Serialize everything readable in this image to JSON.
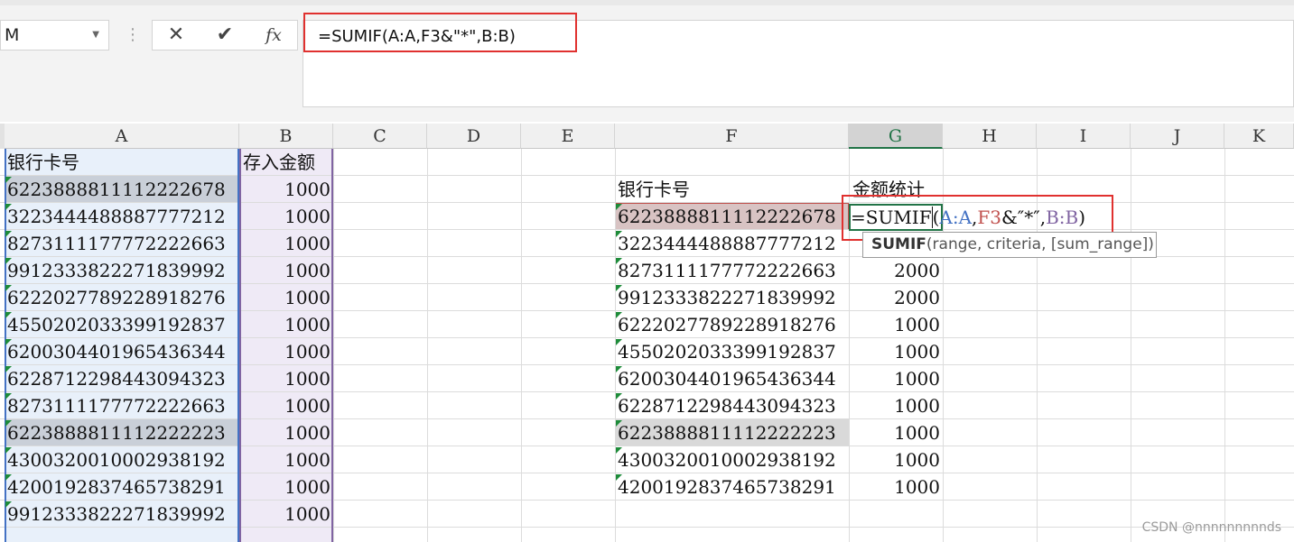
{
  "name_box": {
    "value": "M"
  },
  "formula_bar": {
    "cancel_icon": "✕",
    "enter_icon": "✔",
    "fx_label": "fx",
    "formula": "=SUMIF(A:A,F3&\"*\",B:B)"
  },
  "columns": [
    "A",
    "B",
    "C",
    "D",
    "E",
    "F",
    "G",
    "H",
    "I",
    "J",
    "K"
  ],
  "selected_column": "G",
  "left_table": {
    "header_card": "银行卡号",
    "header_amount": "存入金额",
    "rows": [
      {
        "card": "6223888811112222678",
        "amount": "1000"
      },
      {
        "card": "3223444488887777212",
        "amount": "1000"
      },
      {
        "card": "8273111177772222663",
        "amount": "1000"
      },
      {
        "card": "9912333822271839992",
        "amount": "1000"
      },
      {
        "card": "6222027789228918276",
        "amount": "1000"
      },
      {
        "card": "4550202033399192837",
        "amount": "1000"
      },
      {
        "card": "6200304401965436344",
        "amount": "1000"
      },
      {
        "card": "6228712298443094323",
        "amount": "1000"
      },
      {
        "card": "8273111177772222663",
        "amount": "1000"
      },
      {
        "card": "6223888811112222223",
        "amount": "1000"
      },
      {
        "card": "4300320010002938192",
        "amount": "1000"
      },
      {
        "card": "4200192837465738291",
        "amount": "1000"
      },
      {
        "card": "9912333822271839992",
        "amount": "1000"
      }
    ]
  },
  "right_table": {
    "header_card": "银行卡号",
    "header_total": "金额统计",
    "rows": [
      {
        "card": "6223888811112222678",
        "total": ""
      },
      {
        "card": "3223444488887777212",
        "total": ""
      },
      {
        "card": "8273111177772222663",
        "total": "2000"
      },
      {
        "card": "9912333822271839992",
        "total": "2000"
      },
      {
        "card": "6222027789228918276",
        "total": "1000"
      },
      {
        "card": "4550202033399192837",
        "total": "1000"
      },
      {
        "card": "6200304401965436344",
        "total": "1000"
      },
      {
        "card": "6228712298443094323",
        "total": "1000"
      },
      {
        "card": "6223888811112222223",
        "total": "1000"
      },
      {
        "card": "4300320010002938192",
        "total": "1000"
      },
      {
        "card": "4200192837465738291",
        "total": "1000"
      }
    ]
  },
  "in_cell_formula": {
    "part1": "=SUMIF",
    "part2": "(",
    "part3": "A:A",
    "part4": ",",
    "part5": "F3",
    "part6": "&″*″,",
    "part7": "B:B",
    "part8": ")"
  },
  "tooltip": {
    "fn": "SUMIF",
    "args": "(range, criteria, [sum_range])"
  },
  "watermark": "CSDN @nnnnnnnnnds",
  "colors": {
    "ref_blue": "#4472c4",
    "ref_red": "#c0504d",
    "ref_purple": "#8064a2",
    "highlight_red": "#e0312f",
    "excel_green": "#217346"
  }
}
